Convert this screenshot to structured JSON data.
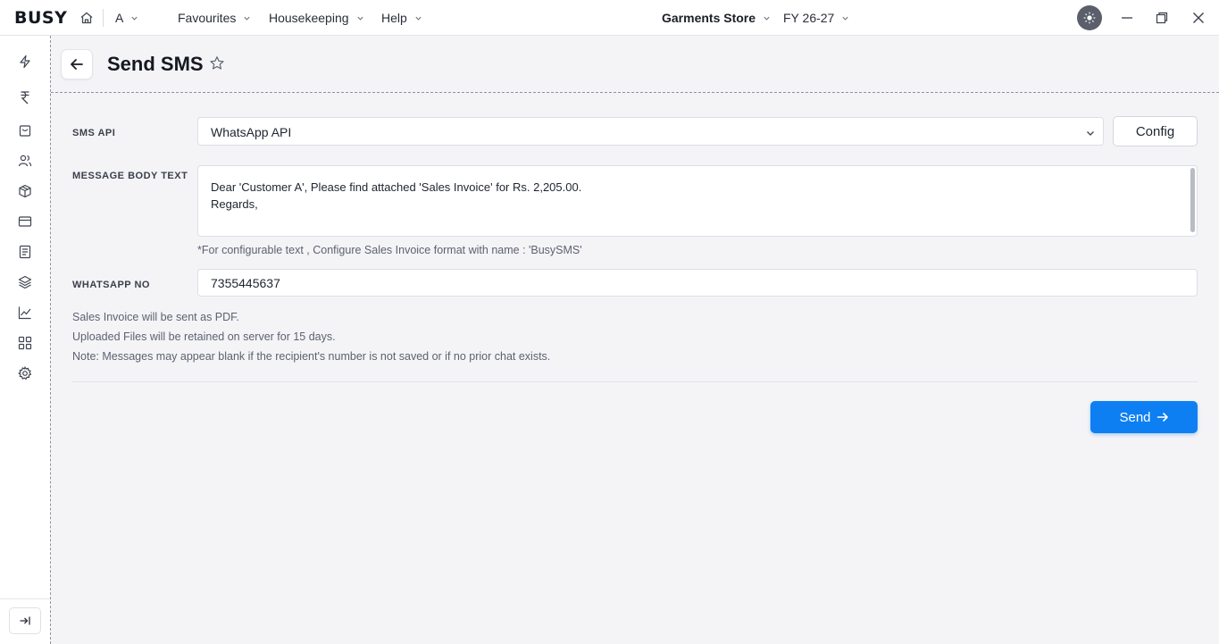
{
  "app": {
    "logo": "BUSY",
    "company_short": "A",
    "menus": [
      "Favourites",
      "Housekeeping",
      "Help"
    ],
    "company_name": "Garments Store",
    "financial_year": "FY 26-27"
  },
  "page": {
    "title": "Send SMS"
  },
  "form": {
    "sms_api_label": "SMS API",
    "sms_api_value": "WhatsApp API",
    "config_label": "Config",
    "message_label": "MESSAGE BODY TEXT",
    "message_lines": [
      "Dear 'Customer A', Please find attached 'Sales Invoice' for Rs. 2,205.00.",
      "Regards,"
    ],
    "hint": "*For configurable text , Configure Sales Invoice format with name : 'BusySMS'",
    "whatsapp_label": "WHATSAPP NO",
    "whatsapp_value": "7355445637",
    "notes": [
      "Sales Invoice will be sent as PDF.",
      "Uploaded Files will be retained on server for 15 days.",
      "Note: Messages may appear blank if the recipient's number is not saved or if no prior chat exists."
    ],
    "send_label": "Send"
  },
  "sidebar_icons": [
    "lightning-icon",
    "rupee-icon",
    "shopping-bag-icon",
    "users-icon",
    "box-icon",
    "credit-card-icon",
    "document-icon",
    "layers-icon",
    "chart-icon",
    "grid-icon",
    "settings-icon"
  ],
  "colors": {
    "accent": "#0d7ff2",
    "background": "#f4f4f7"
  }
}
